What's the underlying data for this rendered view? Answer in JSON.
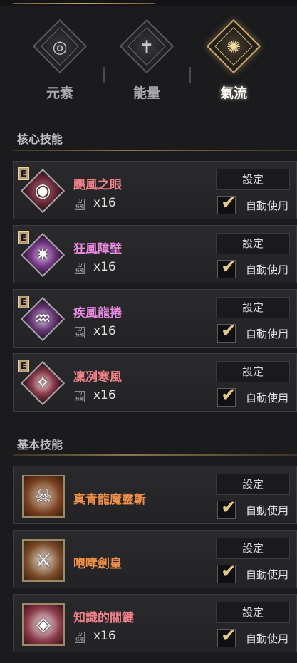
{
  "tabs": [
    {
      "label": "元素",
      "icon": "element-icon",
      "active": false
    },
    {
      "label": "能量",
      "icon": "energy-icon",
      "active": false
    },
    {
      "label": "氣流",
      "icon": "airflow-icon",
      "active": true
    }
  ],
  "sections": {
    "core": {
      "title": "核心技能"
    },
    "basic": {
      "title": "基本技能"
    }
  },
  "common": {
    "setting_label": "設定",
    "auto_use_label": "自動使用",
    "e_badge": "E",
    "qty_icon_text": "LV 技能"
  },
  "core_skills": [
    {
      "name": "颶風之眼",
      "count": "x16",
      "color": "#f0808a",
      "auto_use": true,
      "icon": "hurricane-eye-icon"
    },
    {
      "name": "狂風障壁",
      "count": "x16",
      "color": "#e88ae0",
      "auto_use": true,
      "icon": "gale-barrier-icon"
    },
    {
      "name": "疾風龍捲",
      "count": "x16",
      "color": "#e88ae0",
      "auto_use": true,
      "icon": "tornado-icon"
    },
    {
      "name": "凜冽寒風",
      "count": "x16",
      "color": "#f0808a",
      "auto_use": true,
      "icon": "cold-wind-icon"
    }
  ],
  "basic_skills": [
    {
      "name": "真青龍魔靈斬",
      "count": "",
      "color": "#f09048",
      "auto_use": true,
      "icon": "dragon-spirit-slash-icon"
    },
    {
      "name": "咆哮劍皇",
      "count": "",
      "color": "#f09048",
      "auto_use": true,
      "icon": "roaring-sword-icon"
    },
    {
      "name": "知識的關鍵",
      "count": "x16",
      "color": "#f0808a",
      "auto_use": true,
      "icon": "eye-of-knowledge-icon"
    }
  ]
}
